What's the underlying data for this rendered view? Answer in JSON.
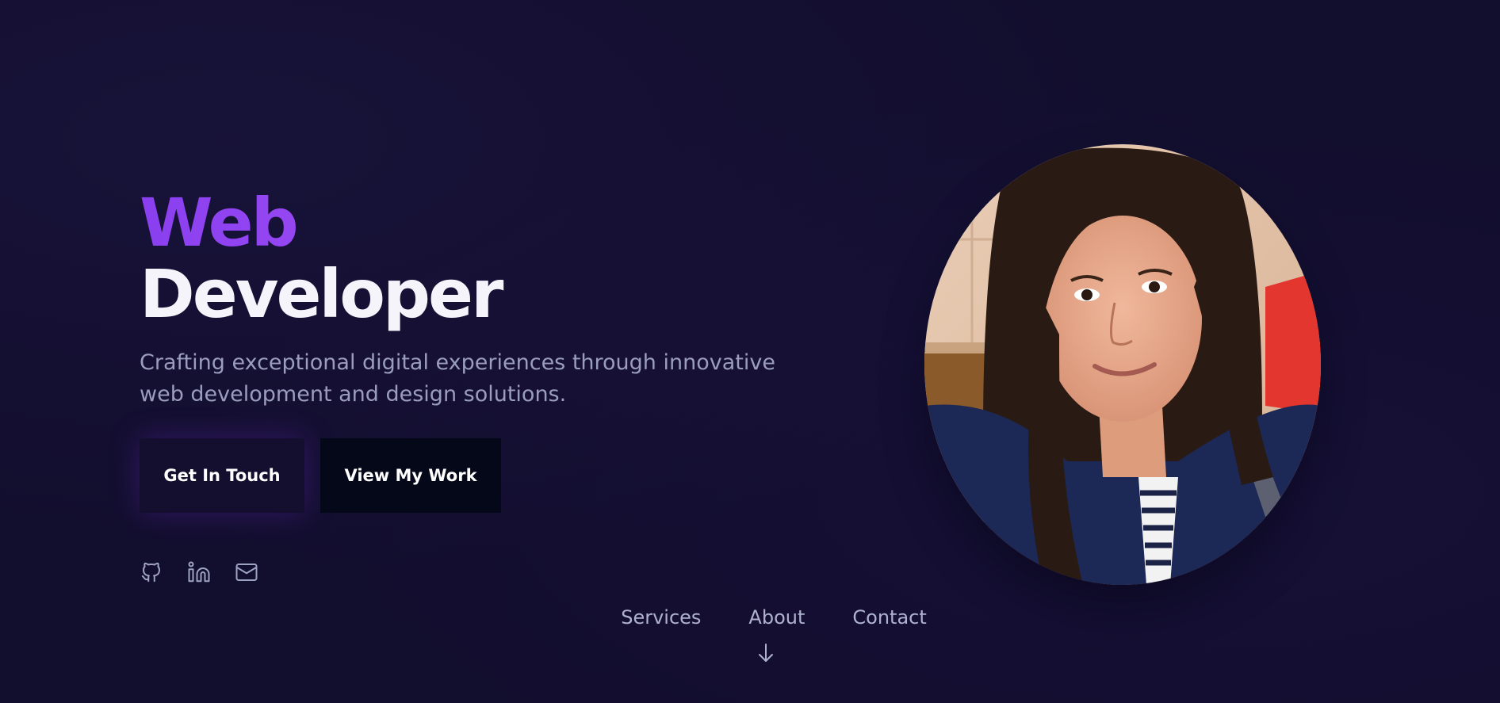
{
  "hero": {
    "title_line1": "Web",
    "title_line2": "Developer",
    "subtitle": "Crafting exceptional digital experiences through innovative web development and design solutions."
  },
  "buttons": {
    "get_in_touch": "Get In Touch",
    "view_my_work": "View My Work"
  },
  "socials": [
    {
      "icon": "github-icon"
    },
    {
      "icon": "linkedin-icon"
    },
    {
      "icon": "mail-icon"
    }
  ],
  "profile": {
    "image": "profile-photo"
  },
  "nav": {
    "items": [
      {
        "label": "Services"
      },
      {
        "label": "About"
      },
      {
        "label": "Contact"
      }
    ],
    "scroll_icon": "arrow-down-icon"
  },
  "colors": {
    "background": "#120e2d",
    "accent_gradient_start": "#8a3ff0",
    "accent_gradient_end": "#b55ef5",
    "text_primary": "#f5f4fb",
    "text_muted": "#9a9dbd"
  }
}
